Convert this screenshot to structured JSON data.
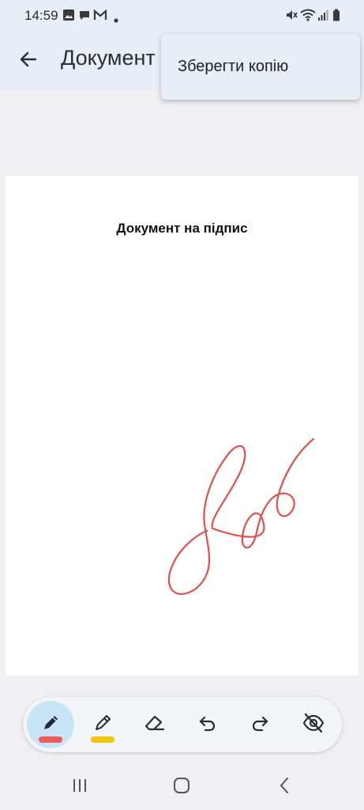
{
  "status_bar": {
    "time": "14:59",
    "icons": [
      "gallery-icon",
      "chat-icon",
      "gmail-icon",
      "dot-icon",
      "mute-icon",
      "wifi-icon",
      "signal-icon",
      "battery-icon"
    ]
  },
  "app_bar": {
    "title": "Документ"
  },
  "menu": {
    "items": [
      {
        "label": "Зберегти копію"
      }
    ]
  },
  "document": {
    "title": "Документ на підпис",
    "signature_color": "#e0504e"
  },
  "toolbar": {
    "tools": [
      {
        "name": "pen",
        "icon": "pen-icon",
        "active": true,
        "color": "#f05a5a"
      },
      {
        "name": "highlighter",
        "icon": "highlighter-icon",
        "active": false,
        "color": "#f6c40a"
      },
      {
        "name": "eraser",
        "icon": "eraser-icon",
        "active": false
      },
      {
        "name": "undo",
        "icon": "undo-icon",
        "active": false
      },
      {
        "name": "redo",
        "icon": "redo-icon",
        "active": false
      },
      {
        "name": "hide",
        "icon": "eye-off-icon",
        "active": false
      }
    ]
  },
  "colors": {
    "appbar_bg": "#e7eef7",
    "active_tool_bg": "#c8e4f7"
  }
}
